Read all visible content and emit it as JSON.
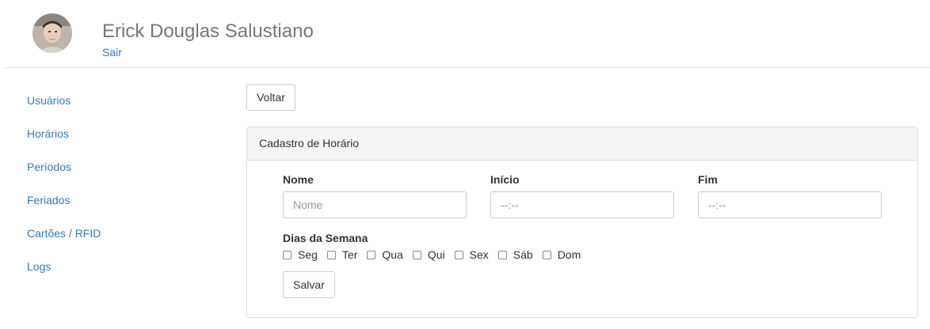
{
  "header": {
    "user_name": "Erick Douglas Salustiano",
    "logout_label": "Sair"
  },
  "sidebar": {
    "items": [
      {
        "label": "Usuários"
      },
      {
        "label": "Horários"
      },
      {
        "label": "Períodos"
      },
      {
        "label": "Feriados"
      },
      {
        "label": "Cartões / RFID"
      },
      {
        "label": "Logs"
      }
    ]
  },
  "main": {
    "back_label": "Voltar",
    "panel": {
      "title": "Cadastro de Horário",
      "fields": {
        "name": {
          "label": "Nome",
          "placeholder": "Nome",
          "value": ""
        },
        "start": {
          "label": "Início",
          "placeholder": "--:--",
          "value": ""
        },
        "end": {
          "label": "Fim",
          "placeholder": "--:--",
          "value": ""
        }
      },
      "days_label": "Dias da Semana",
      "days": [
        {
          "label": "Seg",
          "checked": false
        },
        {
          "label": "Ter",
          "checked": false
        },
        {
          "label": "Qua",
          "checked": false
        },
        {
          "label": "Qui",
          "checked": false
        },
        {
          "label": "Sex",
          "checked": false
        },
        {
          "label": "Sáb",
          "checked": false
        },
        {
          "label": "Dom",
          "checked": false
        }
      ],
      "save_label": "Salvar"
    }
  },
  "colors": {
    "link": "#337ab7",
    "panel_heading_bg": "#f5f5f5",
    "border": "#dddddd"
  },
  "icons": {
    "avatar": "user-photo"
  }
}
